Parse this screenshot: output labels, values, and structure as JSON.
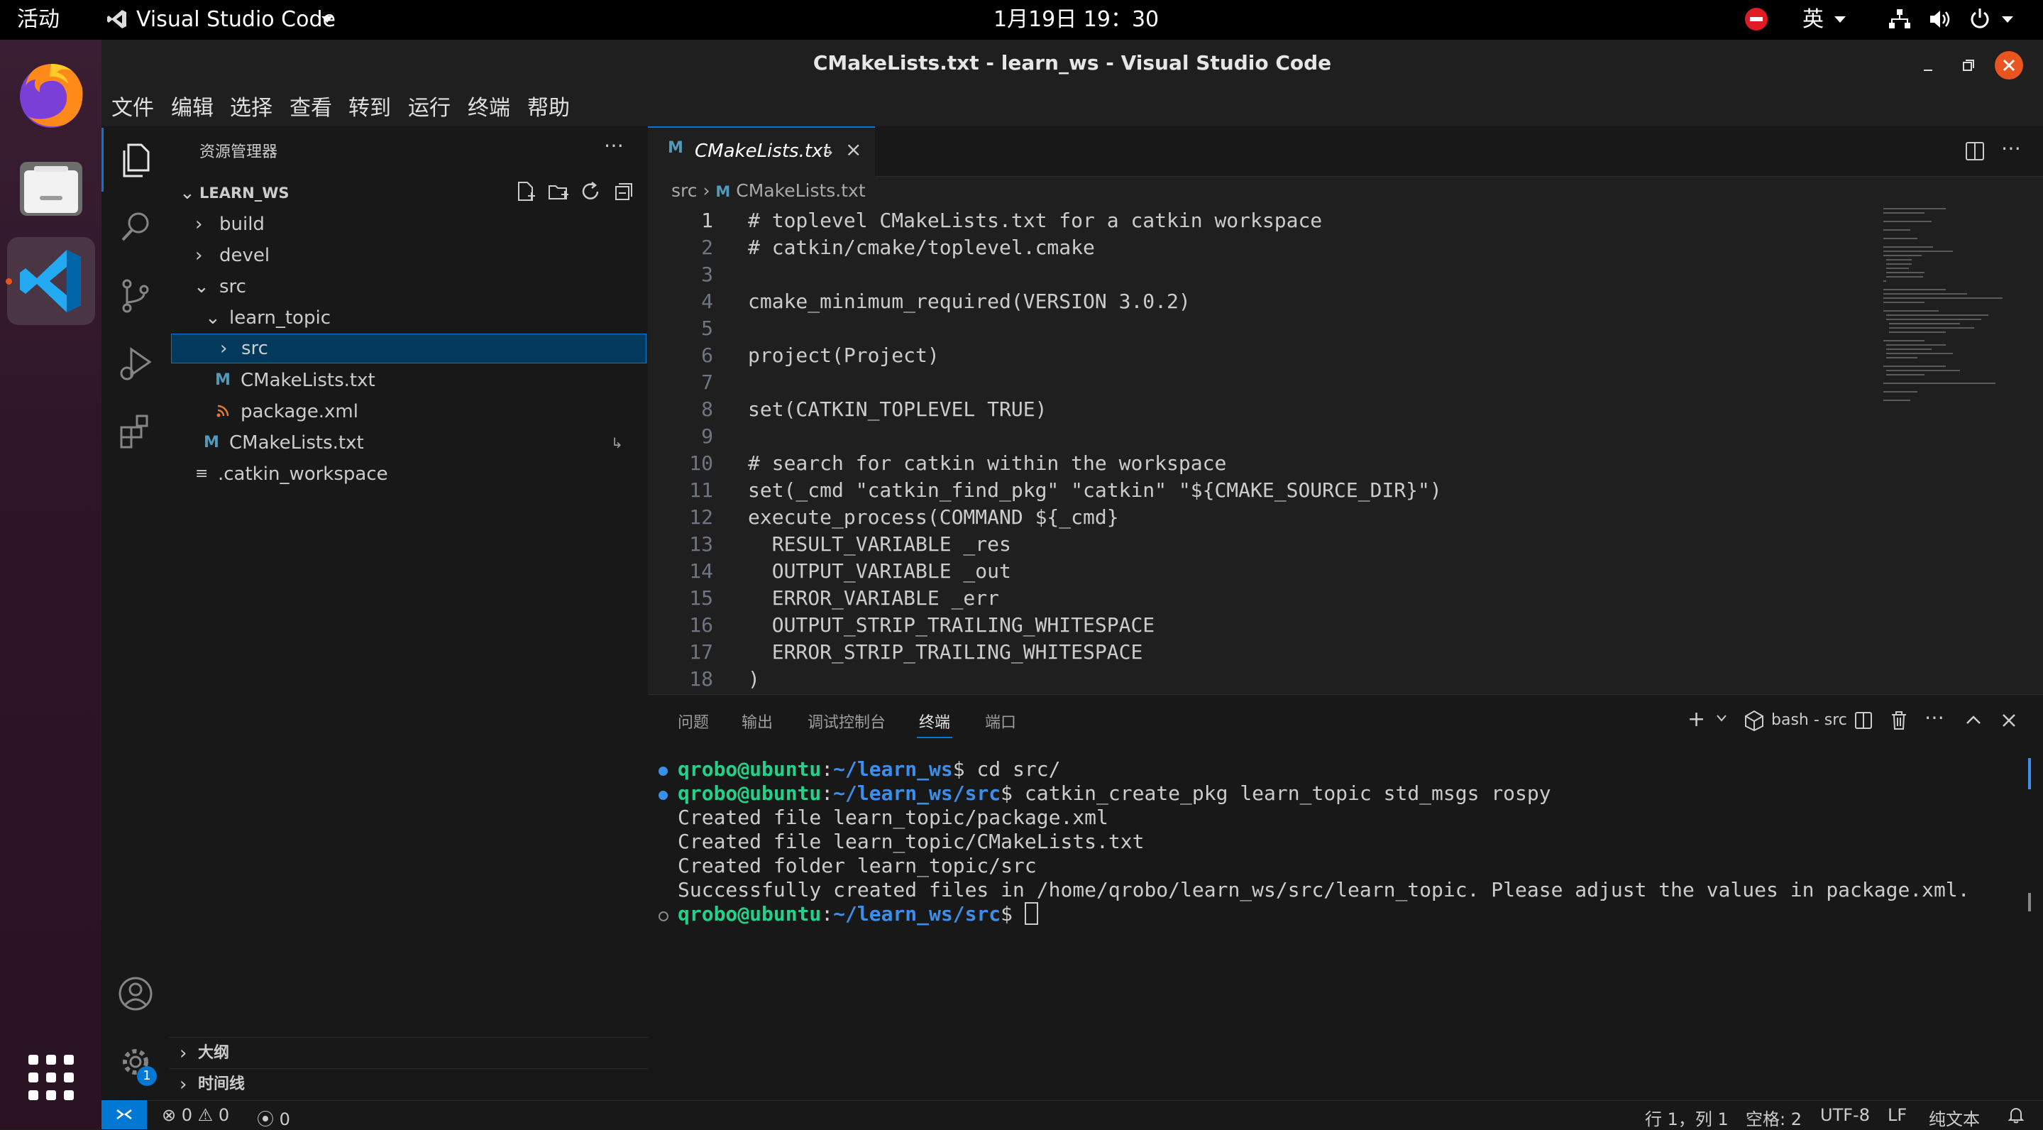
{
  "topbar": {
    "activities": "活动",
    "app_name": "Visual Studio Code",
    "clock": "1月19日 19：30",
    "input_method": "英"
  },
  "window": {
    "title": "CMakeLists.txt - learn_ws - Visual Studio Code"
  },
  "menu": [
    "文件",
    "编辑",
    "选择",
    "查看",
    "转到",
    "运行",
    "终端",
    "帮助"
  ],
  "sidebar": {
    "title": "资源管理器",
    "root": "LEARN_WS",
    "items": [
      {
        "label": "build"
      },
      {
        "label": "devel"
      },
      {
        "label": "src"
      },
      {
        "label": "learn_topic"
      },
      {
        "label": "src"
      },
      {
        "label": "CMakeLists.txt"
      },
      {
        "label": "package.xml"
      },
      {
        "label": "CMakeLists.txt"
      },
      {
        "label": ".catkin_workspace"
      }
    ],
    "outline": "大纲",
    "timeline": "时间线"
  },
  "editor": {
    "tab_label": "CMakeLists.txt",
    "breadcrumb_folder": "src",
    "breadcrumb_file": "CMakeLists.txt",
    "lines": [
      "# toplevel CMakeLists.txt for a catkin workspace",
      "# catkin/cmake/toplevel.cmake",
      "",
      "cmake_minimum_required(VERSION 3.0.2)",
      "",
      "project(Project)",
      "",
      "set(CATKIN_TOPLEVEL TRUE)",
      "",
      "# search for catkin within the workspace",
      "set(_cmd \"catkin_find_pkg\" \"catkin\" \"${CMAKE_SOURCE_DIR}\")",
      "execute_process(COMMAND ${_cmd}",
      "  RESULT_VARIABLE _res",
      "  OUTPUT_VARIABLE _out",
      "  ERROR_VARIABLE _err",
      "  OUTPUT_STRIP_TRAILING_WHITESPACE",
      "  ERROR_STRIP_TRAILING_WHITESPACE",
      ")"
    ],
    "line_numbers": [
      "1",
      "2",
      "3",
      "4",
      "5",
      "6",
      "7",
      "8",
      "9",
      "10",
      "11",
      "12",
      "13",
      "14",
      "15",
      "16",
      "17",
      "18"
    ]
  },
  "panel": {
    "tabs": [
      "问题",
      "输出",
      "调试控制台",
      "终端",
      "端口"
    ],
    "terminal_name": "bash - src",
    "prompt_user": "qrobo@ubuntu",
    "lines": [
      {
        "path": "~/learn_ws",
        "cmd": " cd src/"
      },
      {
        "path": "~/learn_ws/src",
        "cmd": " catkin_create_pkg learn_topic std_msgs rospy"
      }
    ],
    "output": [
      "Created file learn_topic/package.xml",
      "Created file learn_topic/CMakeLists.txt",
      "Created folder learn_topic/src",
      "Successfully created files in /home/qrobo/learn_ws/src/learn_topic. Please adjust the values in package.xml."
    ],
    "last_prompt_path": "~/learn_ws/src"
  },
  "status": {
    "errors": "0",
    "warnings": "0",
    "ports": "0",
    "position": "行 1，列 1",
    "spaces": "空格: 2",
    "encoding": "UTF-8",
    "eol": "LF",
    "language": "纯文本",
    "settings_badge": "1"
  },
  "colors": {
    "accent": "#0078d4",
    "prompt_green": "#23d18b",
    "prompt_blue": "#3b8eea"
  }
}
